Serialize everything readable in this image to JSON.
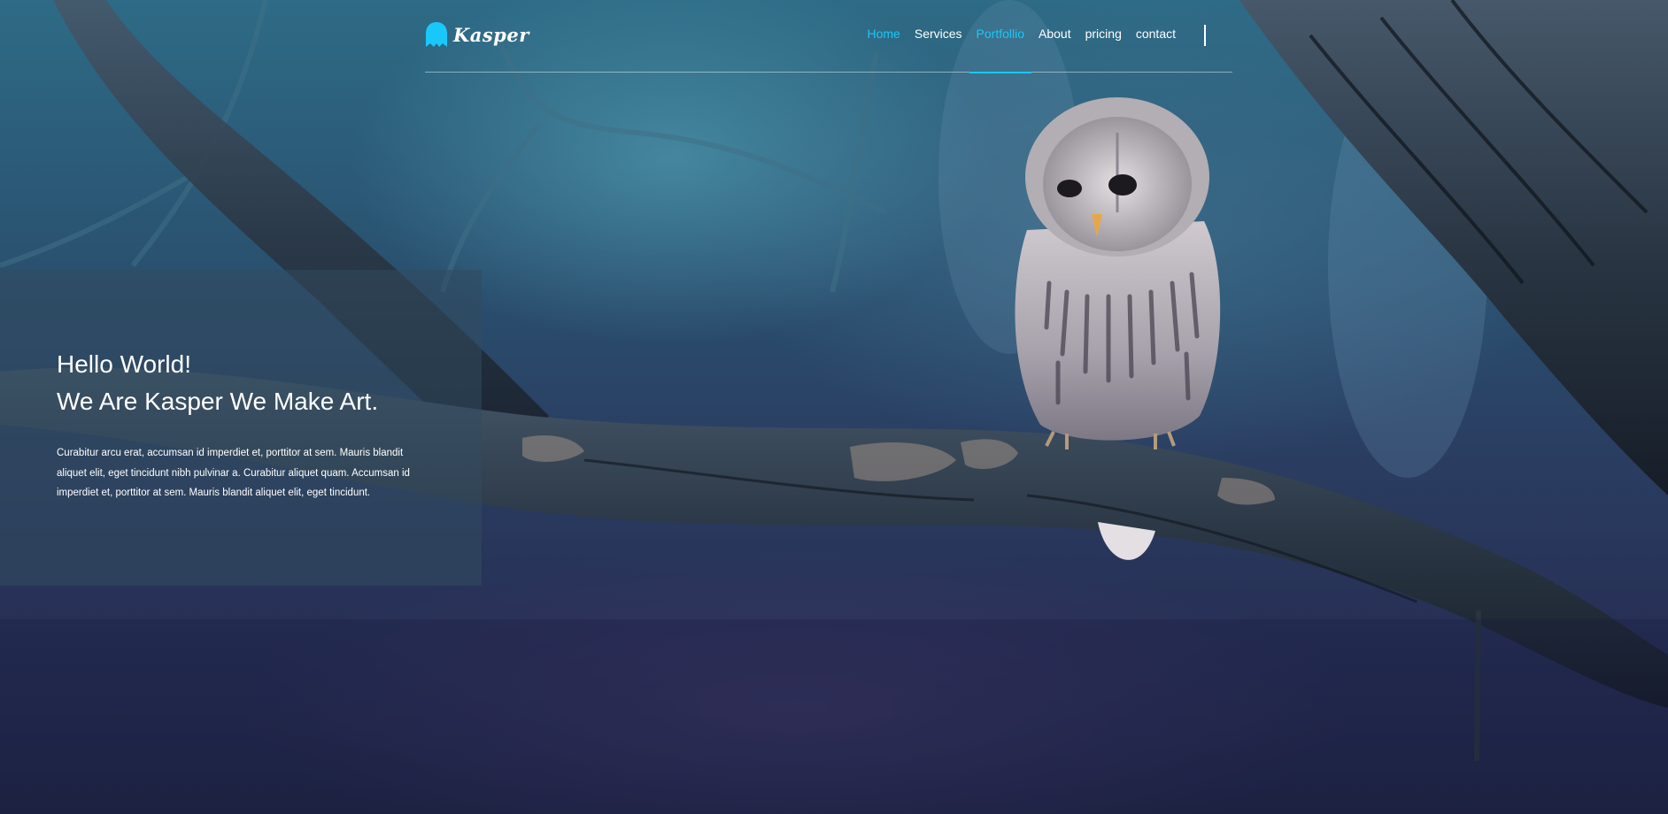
{
  "brand": {
    "name": "Kasper",
    "accent": "#19c8fa",
    "logo_icon": "ghost-icon"
  },
  "nav": {
    "items": [
      {
        "label": "Home",
        "state": "active"
      },
      {
        "label": "Services",
        "state": "normal"
      },
      {
        "label": "Portfollio",
        "state": "hover"
      },
      {
        "label": "About",
        "state": "normal"
      },
      {
        "label": "pricing",
        "state": "normal"
      },
      {
        "label": "contact",
        "state": "normal"
      }
    ],
    "menu_icon": "menu-toggle-icon"
  },
  "intro": {
    "title_line1": "Hello World!",
    "title_line2": "We Are Kasper We Make Art.",
    "description": "Curabitur arcu erat, accumsan id imperdiet et, porttitor at sem. Mauris blandit aliquet elit, eget tincidunt nibh pulvinar a. Curabitur aliquet quam. Accumsan id imperdiet et, porttitor at sem. Mauris blandit aliquet elit, eget tincidunt."
  },
  "background": {
    "subject": "owl-on-branch-image"
  }
}
